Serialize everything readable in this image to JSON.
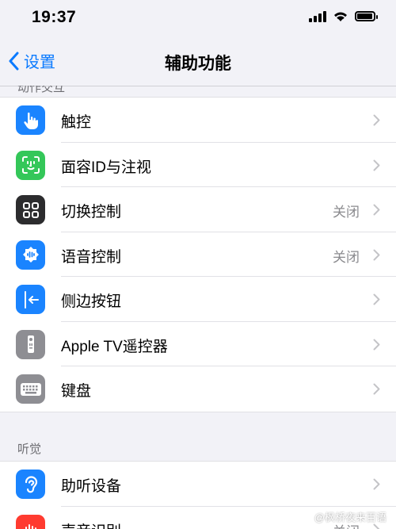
{
  "status_bar": {
    "time": "19:37"
  },
  "nav": {
    "back_label": "设置",
    "title": "辅助功能"
  },
  "sections": [
    {
      "header": "动作交互",
      "rows": [
        {
          "label": "触控",
          "value": "",
          "icon": "hand-tap-icon",
          "color": "#1a84ff"
        },
        {
          "label": "面容ID与注视",
          "value": "",
          "icon": "face-id-icon",
          "color": "#34c759"
        },
        {
          "label": "切换控制",
          "value": "关闭",
          "icon": "switch-control-icon",
          "color": "#2c2c2e"
        },
        {
          "label": "语音控制",
          "value": "关闭",
          "icon": "voice-control-icon",
          "color": "#1a84ff"
        },
        {
          "label": "侧边按钮",
          "value": "",
          "icon": "side-button-icon",
          "color": "#1a84ff"
        },
        {
          "label": "Apple TV遥控器",
          "value": "",
          "icon": "tv-remote-icon",
          "color": "#8e8e93"
        },
        {
          "label": "键盘",
          "value": "",
          "icon": "keyboard-icon",
          "color": "#8e8e93"
        }
      ]
    },
    {
      "header": "听觉",
      "rows": [
        {
          "label": "助听设备",
          "value": "",
          "icon": "ear-icon",
          "color": "#1a84ff"
        },
        {
          "label": "声音识别",
          "value": "关闭",
          "icon": "sound-recognition-icon",
          "color": "#ff3b30"
        }
      ]
    }
  ],
  "watermark": "@枫桥夜来百语"
}
